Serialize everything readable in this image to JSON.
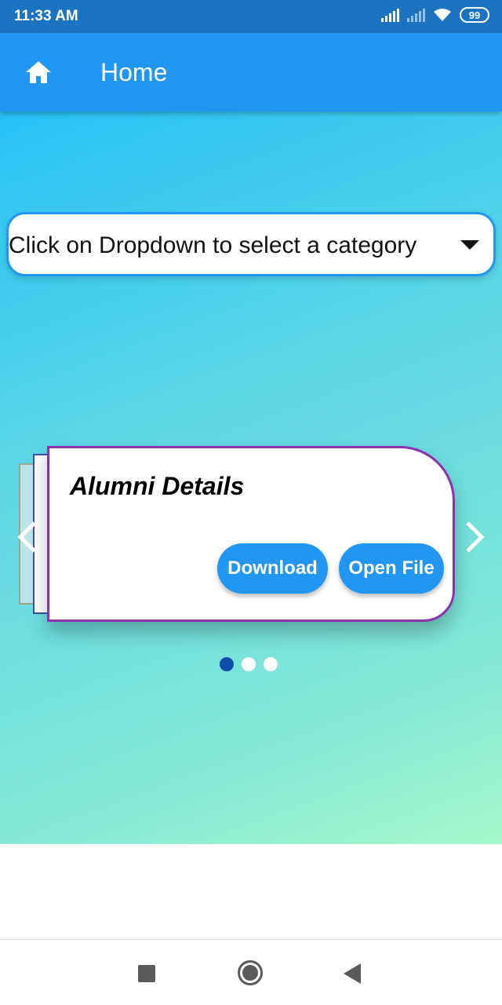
{
  "status_bar": {
    "time": "11:33 AM",
    "battery": "99",
    "icons": [
      "signal-icon",
      "signal-no-service-icon",
      "wifi-icon",
      "battery-icon"
    ]
  },
  "app_bar": {
    "title": "Home",
    "icon": "home-icon",
    "color": "#2196f3"
  },
  "dropdown": {
    "hint": "Click on Dropdown to select a category",
    "icon": "dropdown-arrow-icon"
  },
  "carousel": {
    "cards": [
      {
        "title": "Alumni Details",
        "download_label": "Download",
        "open_label": "Open File"
      }
    ],
    "page_count": 3,
    "active_index": 0,
    "prev_icon": "chevron-left-icon",
    "next_icon": "chevron-right-icon"
  },
  "system_nav": {
    "icons": [
      "recents-square-icon",
      "home-circle-icon",
      "back-triangle-icon"
    ]
  },
  "colors": {
    "accent": "#2196f3",
    "card_border": "#8e2faf",
    "dot_active": "#0d4ea8",
    "gradient_start": "#27c1f6",
    "gradient_end": "#a3f8cc"
  }
}
